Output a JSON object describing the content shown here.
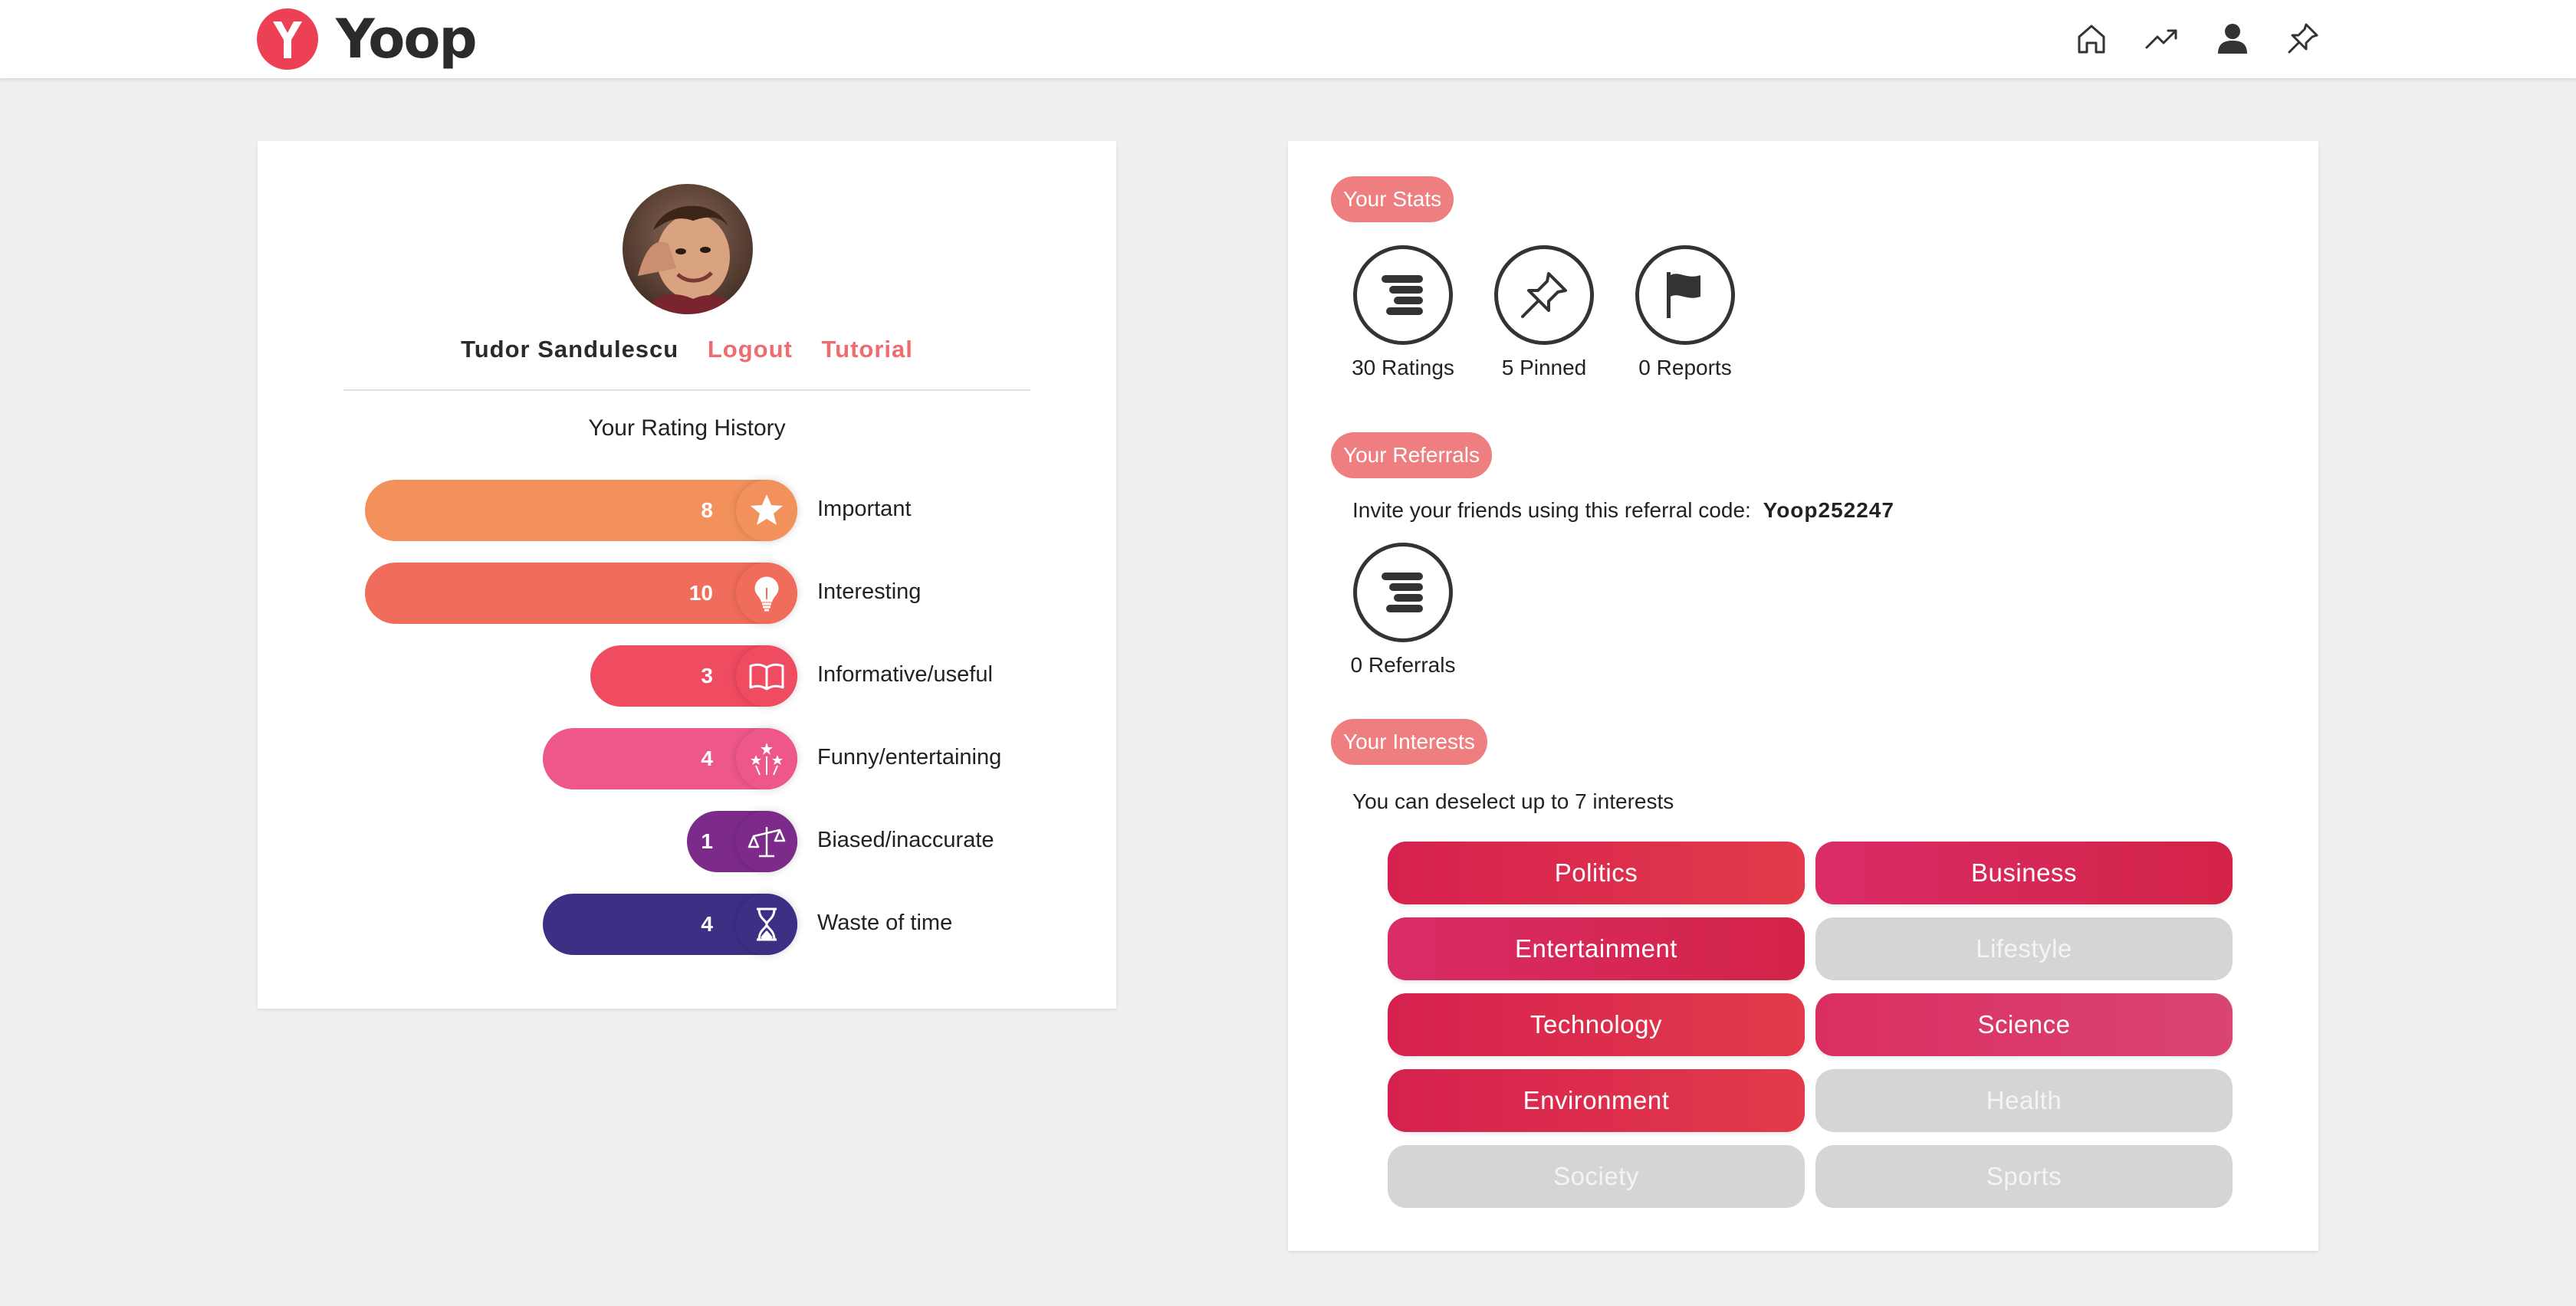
{
  "app": {
    "name": "Yoop",
    "brand_color": "#ee4054"
  },
  "nav": [
    {
      "name": "home",
      "icon": "home-icon"
    },
    {
      "name": "trending",
      "icon": "trending-icon"
    },
    {
      "name": "profile",
      "icon": "user-icon"
    },
    {
      "name": "pinned",
      "icon": "pin-icon"
    }
  ],
  "profile": {
    "user_name": "Tudor Sandulescu",
    "logout_label": "Logout",
    "tutorial_label": "Tutorial",
    "avatar": "avatar-photo"
  },
  "rating_history": {
    "title": "Your Rating History",
    "items": [
      {
        "label": "Important",
        "count": "8",
        "value": 8,
        "icon": "star-icon",
        "color": "#f3915d"
      },
      {
        "label": "Interesting",
        "count": "10",
        "value": 10,
        "icon": "lightbulb-icon",
        "color": "#f06d5b"
      },
      {
        "label": "Informative/useful",
        "count": "3",
        "value": 3,
        "icon": "book-icon",
        "color": "#ef4b61"
      },
      {
        "label": "Funny/entertaining",
        "count": "4",
        "value": 4,
        "icon": "fireworks-icon",
        "color": "#ee5888"
      },
      {
        "label": "Biased/inaccurate",
        "count": "1",
        "value": 1,
        "icon": "scales-icon",
        "color": "#7c2b8a"
      },
      {
        "label": "Waste of time",
        "count": "4",
        "value": 4,
        "icon": "hourglass-icon",
        "color": "#3e2f85"
      }
    ]
  },
  "stats": {
    "heading": "Your Stats",
    "items": [
      {
        "label": "30 Ratings",
        "icon": "ratings-icon"
      },
      {
        "label": "5 Pinned",
        "icon": "pin-icon"
      },
      {
        "label": "0 Reports",
        "icon": "flag-icon"
      }
    ]
  },
  "referrals": {
    "heading": "Your Referrals",
    "invite_text": "Invite your friends using this referral code:",
    "code": "Yoop252247",
    "count_label": "0 Referrals",
    "icon": "ratings-icon"
  },
  "interests": {
    "heading": "Your Interests",
    "hint": "You can deselect up to 7 interests",
    "items": [
      {
        "label": "Politics",
        "selected": true
      },
      {
        "label": "Business",
        "selected": true
      },
      {
        "label": "Entertainment",
        "selected": true
      },
      {
        "label": "Lifestyle",
        "selected": false
      },
      {
        "label": "Technology",
        "selected": true
      },
      {
        "label": "Science",
        "selected": true
      },
      {
        "label": "Environment",
        "selected": true
      },
      {
        "label": "Health",
        "selected": false
      },
      {
        "label": "Society",
        "selected": false
      },
      {
        "label": "Sports",
        "selected": false
      }
    ]
  }
}
